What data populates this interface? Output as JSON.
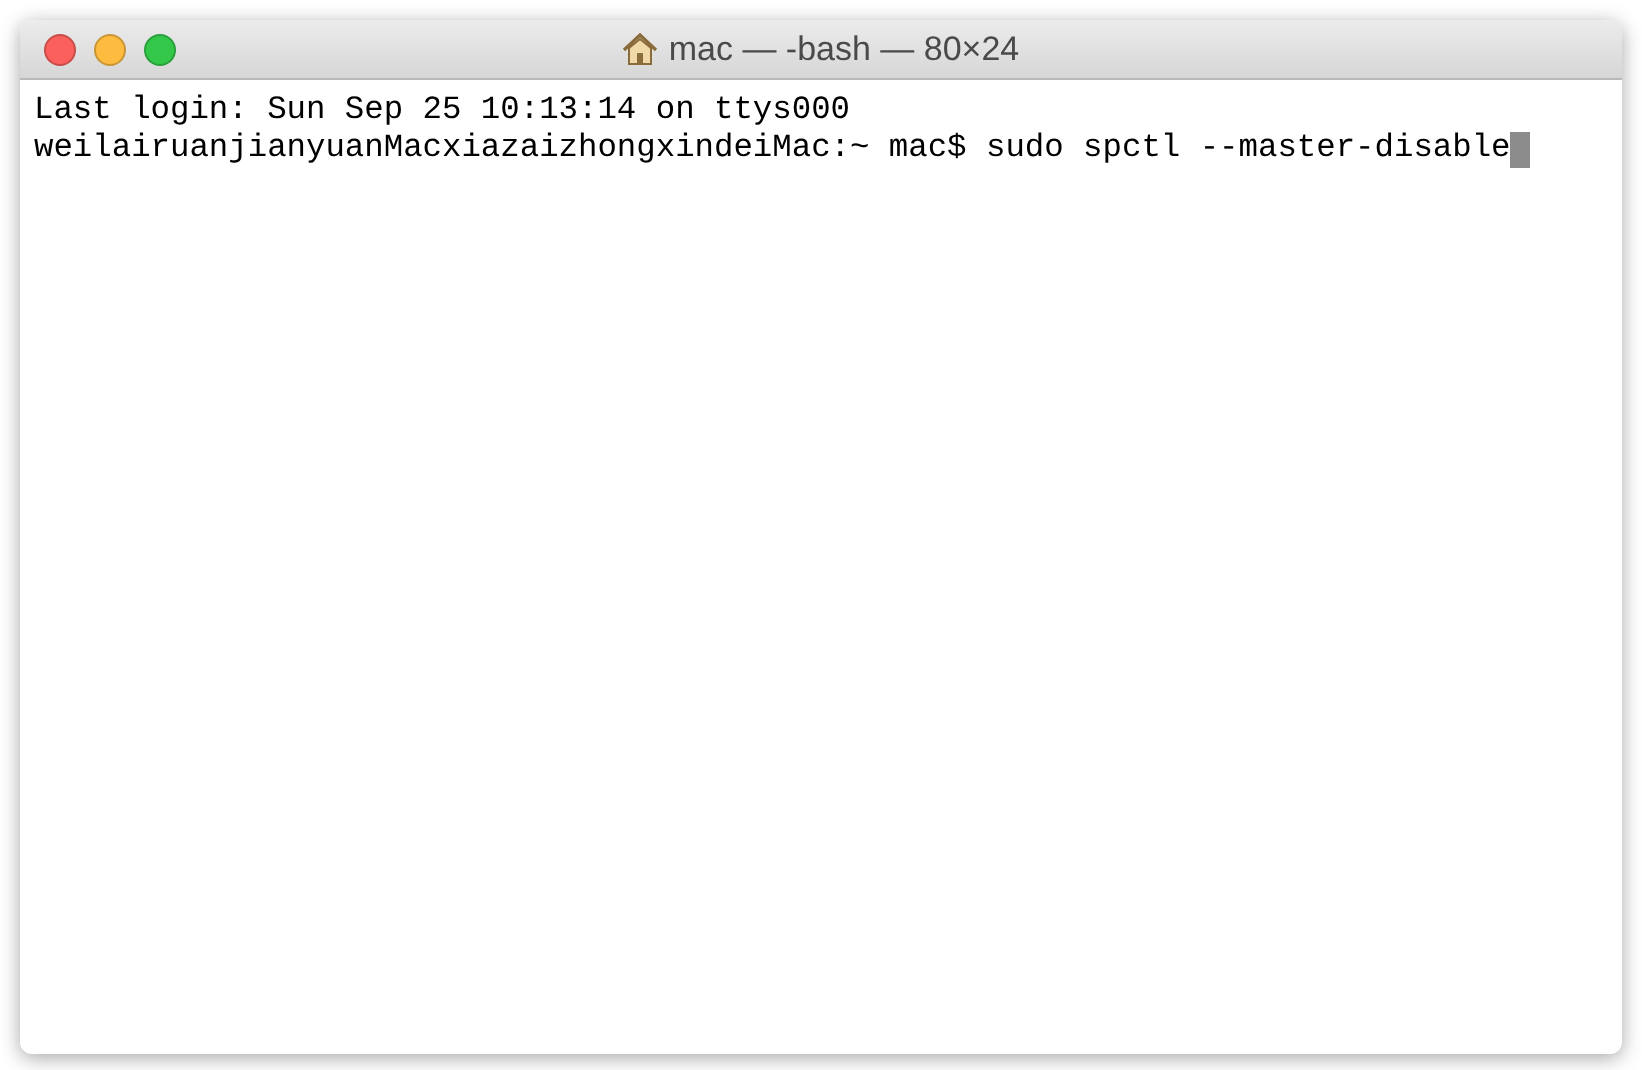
{
  "window": {
    "title": "mac — -bash — 80×24"
  },
  "terminal": {
    "lines": [
      "Last login: Sun Sep 25 10:13:14 on ttys000",
      "weilairuanjianyuanMacxiazaizhongxindeiMac:~ mac$ sudo spctl --master-disable"
    ],
    "cursor_visible": true
  }
}
